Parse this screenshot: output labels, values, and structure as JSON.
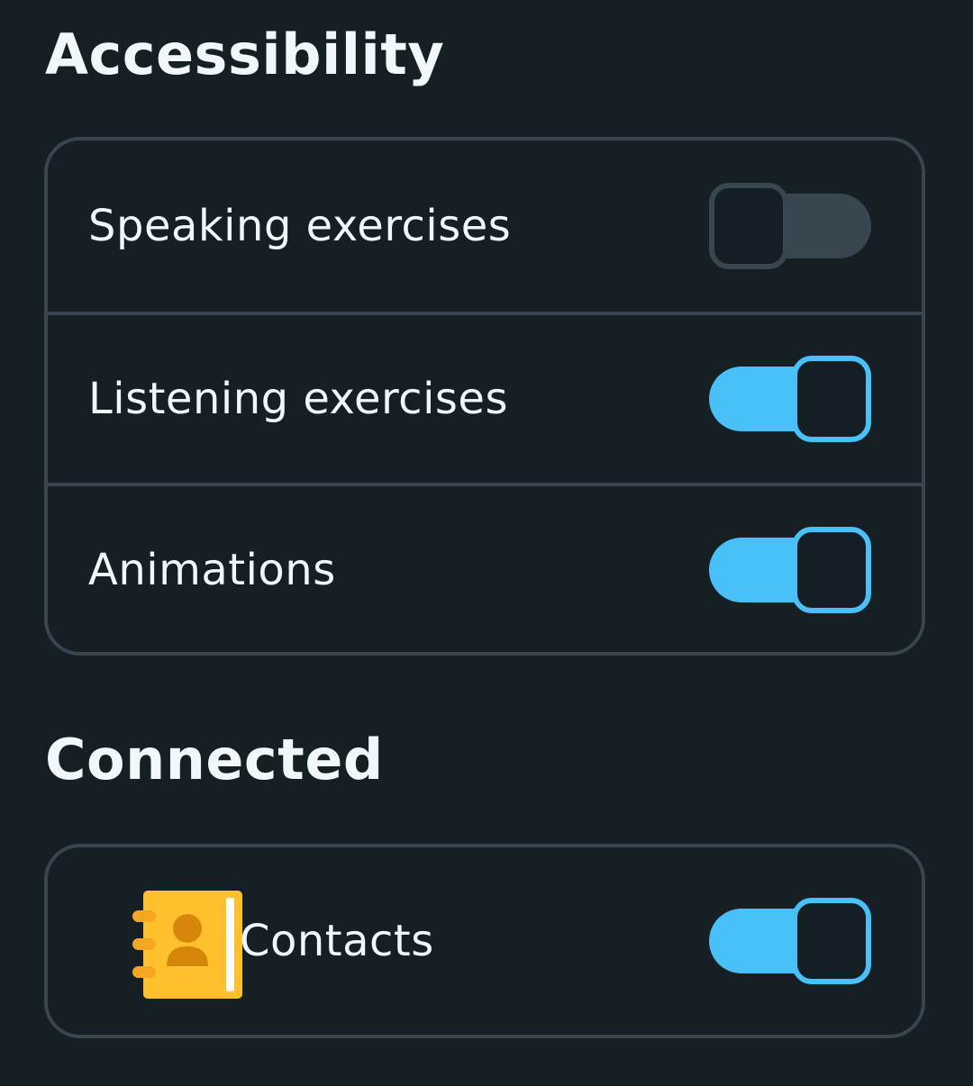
{
  "accessibility": {
    "title": "Accessibility",
    "items": [
      {
        "label": "Speaking exercises",
        "enabled": false
      },
      {
        "label": "Listening exercises",
        "enabled": true
      },
      {
        "label": "Animations",
        "enabled": true
      }
    ]
  },
  "connected": {
    "title": "Connected",
    "items": [
      {
        "label": "Contacts",
        "icon": "contacts-book-icon",
        "enabled": true
      }
    ]
  },
  "colors": {
    "background": "#151f24",
    "border": "#37464f",
    "toggle_on": "#49c0f8",
    "toggle_off": "#37464f",
    "icon_book": "#ffc02e",
    "icon_person": "#d6870b"
  }
}
